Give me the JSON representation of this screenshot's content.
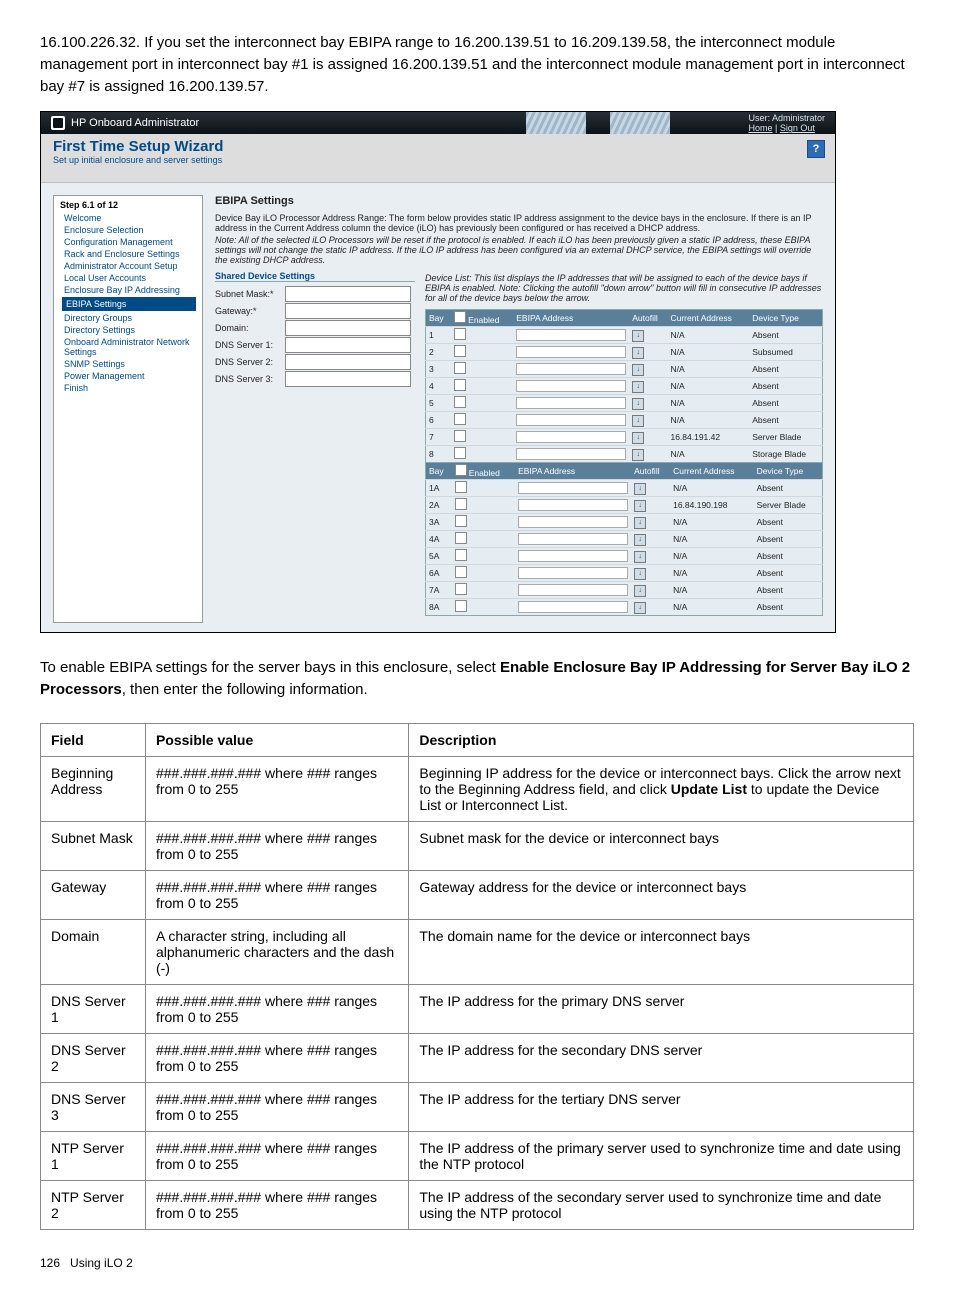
{
  "intro_text": "16.100.226.32. If you set the interconnect bay EBIPA range to 16.200.139.51 to 16.209.139.58, the interconnect module management port in interconnect bay #1 is assigned 16.200.139.51 and the interconnect module management port in interconnect bay #7 is assigned 16.200.139.57.",
  "screenshot": {
    "titlebar": {
      "product": "HP Onboard Administrator",
      "user_line": "User: Administrator",
      "home": "Home",
      "signout": "Sign Out"
    },
    "subheader": {
      "title": "First Time Setup Wizard",
      "subtitle": "Set up initial enclosure and server settings",
      "help": "?"
    },
    "nav": {
      "step": "Step 6.1 of 12",
      "items": [
        "Welcome",
        "Enclosure Selection",
        "Configuration Management",
        "Rack and Enclosure Settings",
        "Administrator Account Setup",
        "Local User Accounts",
        "Enclosure Bay IP Addressing",
        "EBIPA Settings",
        "Directory Groups",
        "Directory Settings",
        "Onboard Administrator Network Settings",
        "SNMP Settings",
        "Power Management",
        "Finish"
      ],
      "active_index": 7
    },
    "main": {
      "heading": "EBIPA Settings",
      "desc1": "Device Bay iLO Processor Address Range: The form below provides static IP address assignment to the device bays in the enclosure. If there is an IP address in the Current Address column the device (iLO) has previously been configured or has received a DHCP address.",
      "desc2": "Note: All of the selected iLO Processors will be reset if the protocol is enabled. If each iLO has been previously given a static IP address, these EBIPA settings will not change the static IP address. If the iLO IP address has been configured via an external DHCP service, the EBIPA settings will override the existing DHCP address.",
      "shared_heading": "Shared Device Settings",
      "shared_fields": [
        "Subnet Mask:*",
        "Gateway:*",
        "Domain:",
        "DNS Server 1:",
        "DNS Server 2:",
        "DNS Server 3:"
      ],
      "device_note": "Device List: This list displays the IP addresses that will be assigned to each of the device bays if EBIPA is enabled. Note: Clicking the autofill \"down arrow\" button will fill in consecutive IP addresses for all of the device bays below the arrow.",
      "table_headers": [
        "Bay",
        "Enabled",
        "EBIPA Address",
        "Autofill",
        "Current Address",
        "Device Type"
      ],
      "rows1": [
        {
          "bay": "1",
          "cur": "N/A",
          "type": "Absent"
        },
        {
          "bay": "2",
          "cur": "N/A",
          "type": "Subsumed"
        },
        {
          "bay": "3",
          "cur": "N/A",
          "type": "Absent"
        },
        {
          "bay": "4",
          "cur": "N/A",
          "type": "Absent"
        },
        {
          "bay": "5",
          "cur": "N/A",
          "type": "Absent"
        },
        {
          "bay": "6",
          "cur": "N/A",
          "type": "Absent"
        },
        {
          "bay": "7",
          "cur": "16.84.191.42",
          "type": "Server Blade"
        },
        {
          "bay": "8",
          "cur": "N/A",
          "type": "Storage Blade"
        }
      ],
      "rows2": [
        {
          "bay": "1A",
          "cur": "N/A",
          "type": "Absent"
        },
        {
          "bay": "2A",
          "cur": "16.84.190.198",
          "type": "Server Blade"
        },
        {
          "bay": "3A",
          "cur": "N/A",
          "type": "Absent"
        },
        {
          "bay": "4A",
          "cur": "N/A",
          "type": "Absent"
        },
        {
          "bay": "5A",
          "cur": "N/A",
          "type": "Absent"
        },
        {
          "bay": "6A",
          "cur": "N/A",
          "type": "Absent"
        },
        {
          "bay": "7A",
          "cur": "N/A",
          "type": "Absent"
        },
        {
          "bay": "8A",
          "cur": "N/A",
          "type": "Absent"
        }
      ]
    }
  },
  "enable_para_pre": "To enable EBIPA settings for the server bays in this enclosure, select ",
  "enable_para_bold": "Enable Enclosure Bay IP Addressing for Server Bay iLO 2 Processors",
  "enable_para_post": ", then enter the following information.",
  "field_table": {
    "headers": [
      "Field",
      "Possible value",
      "Description"
    ],
    "rows": [
      {
        "f": "Beginning Address",
        "v": "###.###.###.### where ### ranges from 0 to 255",
        "d": "Beginning IP address for the device or interconnect bays. Click the arrow next to the Beginning Address field, and click Update List to update the Device List or Interconnect List.",
        "d_bold": "Update List"
      },
      {
        "f": "Subnet Mask",
        "v": "###.###.###.### where ### ranges from 0 to 255",
        "d": "Subnet mask for the device or interconnect bays"
      },
      {
        "f": "Gateway",
        "v": "###.###.###.### where ### ranges from 0 to 255",
        "d": "Gateway address for the device or interconnect bays"
      },
      {
        "f": "Domain",
        "v": "A character string, including all alphanumeric characters and the dash (-)",
        "d": "The domain name for the device or interconnect bays"
      },
      {
        "f": "DNS Server 1",
        "v": "###.###.###.### where ### ranges from 0 to 255",
        "d": "The IP address for the primary DNS server"
      },
      {
        "f": "DNS Server 2",
        "v": "###.###.###.### where ### ranges from 0 to 255",
        "d": "The IP address for the secondary DNS server"
      },
      {
        "f": "DNS Server 3",
        "v": "###.###.###.### where ### ranges from 0 to 255",
        "d": "The IP address for the tertiary DNS server"
      },
      {
        "f": "NTP Server 1",
        "v": "###.###.###.### where ### ranges from 0 to 255",
        "d": "The IP address of the primary server used to synchronize time and date using the NTP protocol"
      },
      {
        "f": "NTP Server 2",
        "v": "###.###.###.### where ### ranges from 0 to 255",
        "d": "The IP address of the secondary server used to synchronize time and date using the NTP protocol"
      }
    ]
  },
  "footer": {
    "page": "126",
    "section": "Using iLO 2"
  }
}
